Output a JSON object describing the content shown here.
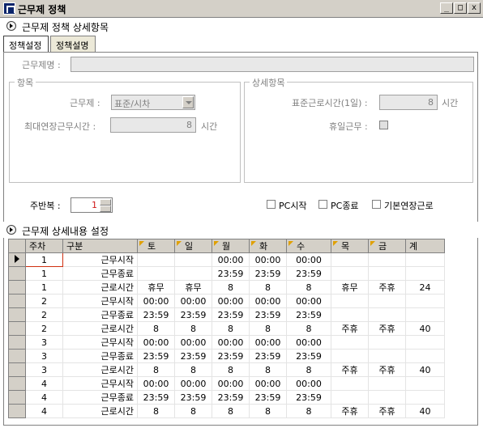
{
  "window": {
    "title": "근무제 정책",
    "min": "_",
    "max": "□",
    "close": "x"
  },
  "header": {
    "label": "근무제 정책 상세항목"
  },
  "tabs": [
    {
      "label": "정책설정"
    },
    {
      "label": "정책설명"
    }
  ],
  "policy_name": {
    "label": "근무제명 :",
    "value": ""
  },
  "group_items": {
    "title": "항목",
    "work_type_label": "근무제 :",
    "work_type_value": "표준/시차",
    "max_ext_label": "최대연장근무시간 :",
    "max_ext_value": "8",
    "max_ext_unit": "시간"
  },
  "group_detail": {
    "title": "상세항목",
    "std_hours_label": "표준근로시간(1일) :",
    "std_hours_value": "8",
    "std_hours_unit": "시간",
    "holiday_label": "휴일근무 :"
  },
  "cycle": {
    "label": "주반복 :",
    "value": "1"
  },
  "checks": {
    "pc_start": "PC시작",
    "pc_end": "PC종료",
    "base_ext": "기본연장근로"
  },
  "detail_head": {
    "label": "근무제 상세내용 설정"
  },
  "grid": {
    "columns": [
      "주차",
      "구분",
      "토",
      "일",
      "월",
      "화",
      "수",
      "목",
      "금",
      "계"
    ],
    "rows": [
      [
        "1",
        "근무시작",
        "",
        "",
        "00:00",
        "00:00",
        "00:00",
        "",
        "",
        ""
      ],
      [
        "1",
        "근무종료",
        "",
        "",
        "23:59",
        "23:59",
        "23:59",
        "",
        "",
        ""
      ],
      [
        "1",
        "근로시간",
        "휴무",
        "휴무",
        "8",
        "8",
        "8",
        "휴무",
        "주휴",
        "24"
      ],
      [
        "2",
        "근무시작",
        "00:00",
        "00:00",
        "00:00",
        "00:00",
        "00:00",
        "",
        "",
        ""
      ],
      [
        "2",
        "근무종료",
        "23:59",
        "23:59",
        "23:59",
        "23:59",
        "23:59",
        "",
        "",
        ""
      ],
      [
        "2",
        "근로시간",
        "8",
        "8",
        "8",
        "8",
        "8",
        "주휴",
        "주휴",
        "40"
      ],
      [
        "3",
        "근무시작",
        "00:00",
        "00:00",
        "00:00",
        "00:00",
        "00:00",
        "",
        "",
        ""
      ],
      [
        "3",
        "근무종료",
        "23:59",
        "23:59",
        "23:59",
        "23:59",
        "23:59",
        "",
        "",
        ""
      ],
      [
        "3",
        "근로시간",
        "8",
        "8",
        "8",
        "8",
        "8",
        "주휴",
        "주휴",
        "40"
      ],
      [
        "4",
        "근무시작",
        "00:00",
        "00:00",
        "00:00",
        "00:00",
        "00:00",
        "",
        "",
        ""
      ],
      [
        "4",
        "근무종료",
        "23:59",
        "23:59",
        "23:59",
        "23:59",
        "23:59",
        "",
        "",
        ""
      ],
      [
        "4",
        "근로시간",
        "8",
        "8",
        "8",
        "8",
        "8",
        "주휴",
        "주휴",
        "40"
      ]
    ]
  }
}
